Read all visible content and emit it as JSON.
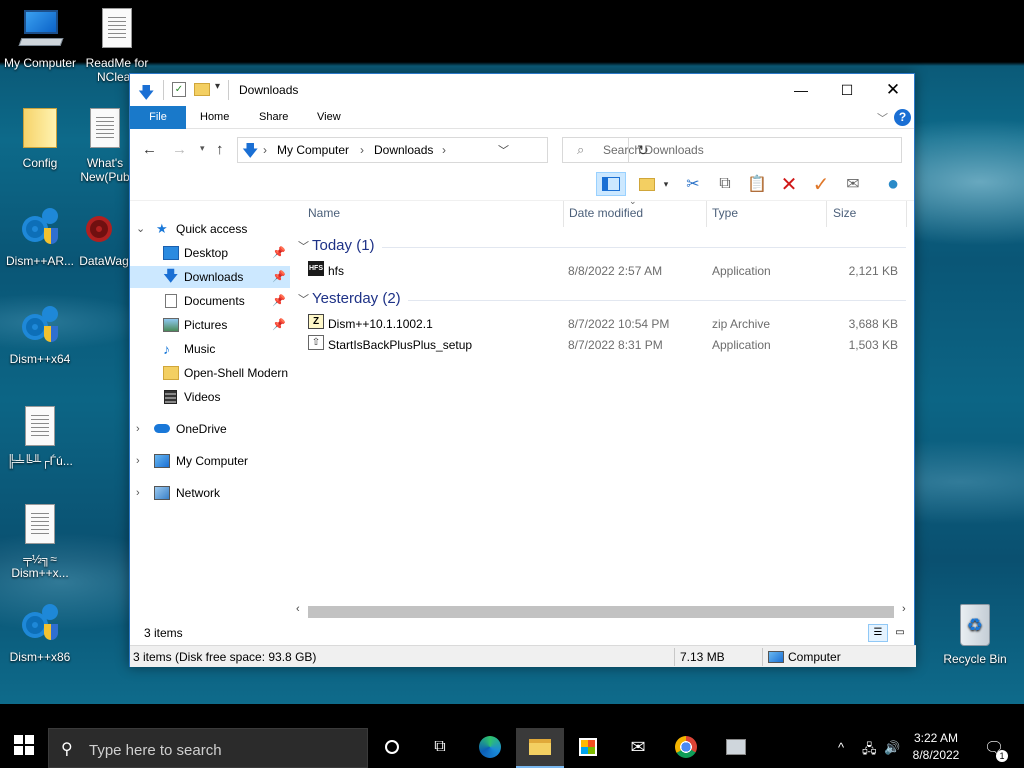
{
  "desktop": {
    "icons": [
      {
        "label": "My Computer",
        "icon": "computer-icon"
      },
      {
        "label": "ReadMe for NClean",
        "icon": "document-icon"
      },
      {
        "label": "Config",
        "icon": "folder-icon"
      },
      {
        "label": "What's New(Pub",
        "icon": "document-icon"
      },
      {
        "label": "Dism++AR...",
        "icon": "dism-gear-icon"
      },
      {
        "label": "DataWag",
        "icon": "datawag-icon"
      },
      {
        "label": "Dism++x64",
        "icon": "dism-gear-icon"
      },
      {
        "label": "╠╧╚╨┌Ѓú...",
        "icon": "document-icon"
      },
      {
        "label": "╤½╗≈ Dism++x...",
        "icon": "document-icon"
      },
      {
        "label": "Dism++x86",
        "icon": "dism-gear-icon"
      },
      {
        "label": "Recycle Bin",
        "icon": "recycle-bin-icon"
      }
    ]
  },
  "window": {
    "title": "Downloads",
    "ribbon_tabs": [
      "File",
      "Home",
      "Share",
      "View"
    ],
    "address": {
      "segments": [
        "My Computer",
        "Downloads"
      ]
    },
    "search": {
      "placeholder": "Search Downloads"
    },
    "nav": {
      "quick_access": "Quick access",
      "items": [
        {
          "label": "Desktop",
          "icon": "desktop-icon",
          "pinned": true
        },
        {
          "label": "Downloads",
          "icon": "downloads-icon",
          "pinned": true,
          "selected": true
        },
        {
          "label": "Documents",
          "icon": "documents-icon",
          "pinned": true
        },
        {
          "label": "Pictures",
          "icon": "pictures-icon",
          "pinned": true
        },
        {
          "label": "Music",
          "icon": "music-icon",
          "pinned": false
        },
        {
          "label": "Open-Shell Modern",
          "icon": "folder-icon",
          "pinned": false
        },
        {
          "label": "Videos",
          "icon": "videos-icon",
          "pinned": false
        }
      ],
      "roots": [
        {
          "label": "OneDrive",
          "icon": "onedrive-icon"
        },
        {
          "label": "My Computer",
          "icon": "computer-icon"
        },
        {
          "label": "Network",
          "icon": "network-icon"
        }
      ]
    },
    "columns": [
      "Name",
      "Date modified",
      "Type",
      "Size"
    ],
    "groups": [
      {
        "label": "Today (1)",
        "files": [
          {
            "name": "hfs",
            "date": "8/8/2022 2:57 AM",
            "type": "Application",
            "size": "2,121 KB",
            "icon": "hfs-app-icon"
          }
        ]
      },
      {
        "label": "Yesterday (2)",
        "files": [
          {
            "name": "Dism++10.1.1002.1",
            "date": "8/7/2022 10:54 PM",
            "type": "zip Archive",
            "size": "3,688 KB",
            "icon": "zip-archive-icon"
          },
          {
            "name": "StartIsBackPlusPlus_setup",
            "date": "8/7/2022 8:31 PM",
            "type": "Application",
            "size": "1,503 KB",
            "icon": "setup-app-icon"
          }
        ]
      }
    ],
    "status": {
      "count": "3 items",
      "bar_info": "3 items (Disk free space: 93.8 GB)",
      "bar_size": "7.13 MB",
      "bar_location": "Computer"
    }
  },
  "taskbar": {
    "search_placeholder": "Type here to search",
    "time": "3:22 AM",
    "date": "8/8/2022",
    "notification_count": "1"
  }
}
